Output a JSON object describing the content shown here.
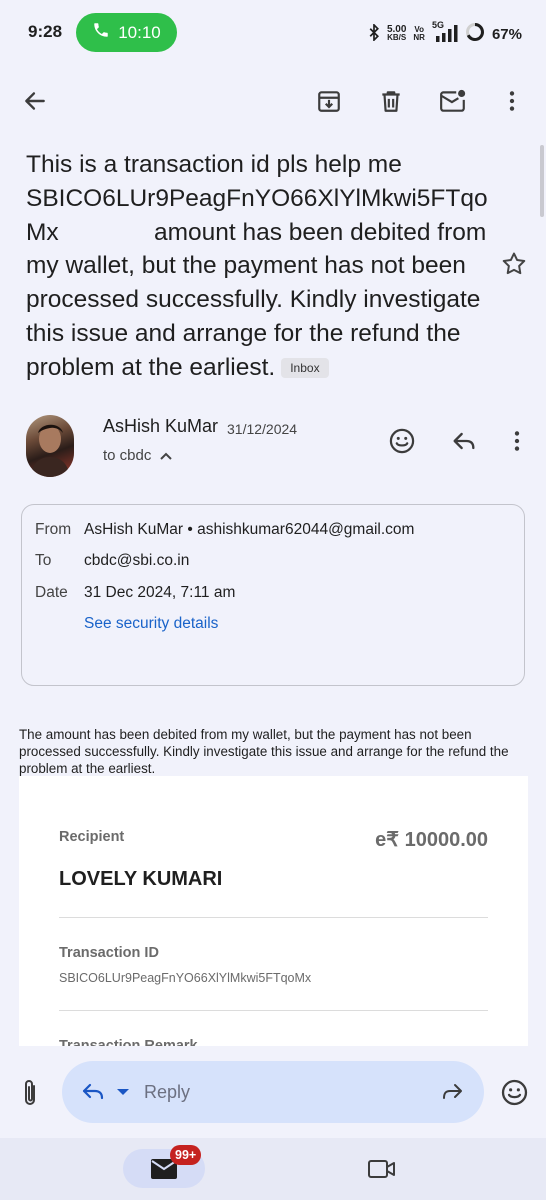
{
  "status_bar": {
    "time": "9:28",
    "call_duration": "10:10",
    "net_speed": "5.00",
    "net_speed_unit": "KB/S",
    "volte_top": "Vo",
    "volte_bottom": "NR",
    "network": "5G",
    "battery": "67%"
  },
  "email": {
    "subject": "This is a transaction id pls help me SBICO6LUr9PeagFnYO66XlYlMkwi5FTqo Mx              amount has been debited from my wallet, but the payment has not been processed successfully. Kindly investigate this issue and arrange for the refund the problem at the earliest.",
    "label": "Inbox",
    "sender_name": "AsHish KuMar",
    "date": "31/12/2024",
    "to_summary": "to cbdc"
  },
  "details": {
    "from_label": "From",
    "from_value": "AsHish KuMar • ashishkumar62044@gmail.com",
    "to_label": "To",
    "to_value": "cbdc@sbi.co.in",
    "date_label": "Date",
    "date_value": "31 Dec 2024, 7:11 am",
    "security_link": "See security details"
  },
  "body": {
    "text": "The amount has been debited from my wallet, but the payment has not been processed successfully. Kindly investigate this issue and arrange for the refund the problem at the earliest."
  },
  "receipt": {
    "recipient_label": "Recipient",
    "amount": "e₹ 10000.00",
    "recipient_name": "LOVELY KUMARI",
    "txid_label": "Transaction ID",
    "txid_value": "SBICO6LUr9PeagFnYO66XlYlMkwi5FTqoMx",
    "remark_label": "Transaction Remark"
  },
  "reply": {
    "placeholder": "Reply"
  },
  "nav": {
    "mail_badge": "99+"
  },
  "colors": {
    "call_green": "#2fbf4a",
    "link_blue": "#1a63c9",
    "badge_red": "#c5221f",
    "reply_pill": "#d6e2fb"
  }
}
